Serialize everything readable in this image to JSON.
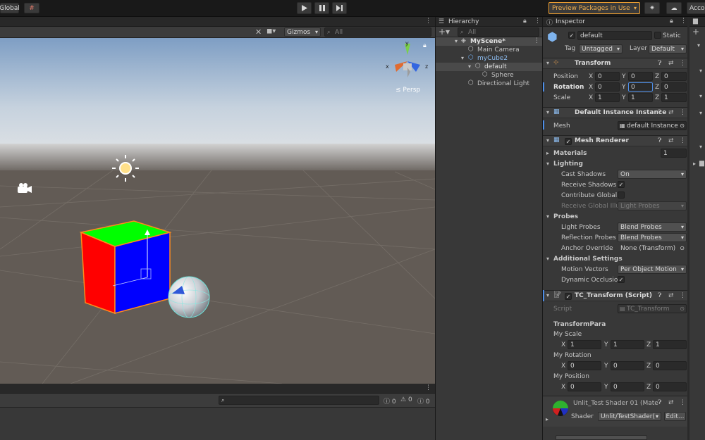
{
  "toolbar": {
    "global_label": "Global",
    "preview_packages": "Preview Packages in Use",
    "account_label": "Acco"
  },
  "scene": {
    "gizmos_label": "Gizmos",
    "search_placeholder": "All",
    "persp_label": "≤ Persp",
    "axis_x": "x",
    "axis_y": "y",
    "axis_z": "z"
  },
  "console": {
    "search_placeholder": "",
    "count_info": "0",
    "count_warn": "0",
    "count_error": "0"
  },
  "hierarchy": {
    "title": "Hierarchy",
    "search_placeholder": "All",
    "items": [
      {
        "label": "MyScene*"
      },
      {
        "label": "Main Camera"
      },
      {
        "label": "myCube2"
      },
      {
        "label": "default"
      },
      {
        "label": "Sphere"
      },
      {
        "label": "Directional Light"
      }
    ]
  },
  "inspector": {
    "title": "Inspector",
    "object_name": "default",
    "static_label": "Static",
    "tag_label": "Tag",
    "tag_value": "Untagged",
    "layer_label": "Layer",
    "layer_value": "Default",
    "transform": {
      "title": "Transform",
      "position_label": "Position",
      "rotation_label": "Rotation",
      "scale_label": "Scale",
      "position": {
        "x": "0",
        "y": "0",
        "z": "0"
      },
      "rotation": {
        "x": "0",
        "y": "0",
        "z": "0"
      },
      "scale": {
        "x": "1",
        "y": "1",
        "z": "1"
      }
    },
    "default_instance": {
      "title": "Default Instance Instance",
      "mesh_label": "Mesh",
      "mesh_value": "default Instance"
    },
    "mesh_renderer": {
      "title": "Mesh Renderer",
      "materials_label": "Materials",
      "materials_count": "1",
      "lighting_label": "Lighting",
      "cast_shadows_label": "Cast Shadows",
      "cast_shadows_value": "On",
      "receive_shadows_label": "Receive Shadows",
      "contribute_gi_label": "Contribute Global I",
      "receive_gi_label": "Receive Global Illu",
      "receive_gi_value": "Light Probes",
      "probes_label": "Probes",
      "light_probes_label": "Light Probes",
      "light_probes_value": "Blend Probes",
      "reflection_probes_label": "Reflection Probes",
      "reflection_probes_value": "Blend Probes",
      "anchor_override_label": "Anchor Override",
      "anchor_override_value": "None (Transform)",
      "additional_label": "Additional Settings",
      "motion_vectors_label": "Motion Vectors",
      "motion_vectors_value": "Per Object Motion",
      "dynamic_occlusion_label": "Dynamic Occlusio"
    },
    "tc_transform": {
      "title": "TC_Transform (Script)",
      "script_label": "Script",
      "script_value": "TC_Transform",
      "transform_para_label": "TransformPara",
      "my_scale_label": "My Scale",
      "my_rotation_label": "My Rotation",
      "my_position_label": "My Position",
      "my_scale": {
        "x": "1",
        "y": "1",
        "z": "1"
      },
      "my_rotation": {
        "x": "0",
        "y": "0",
        "z": "0"
      },
      "my_position": {
        "x": "0",
        "y": "0",
        "z": "0"
      }
    },
    "material": {
      "title": "Unlit_Test Shader 01 (Mate",
      "shader_label": "Shader",
      "shader_value": "Unlit/TestShader(",
      "edit_label": "Edit..."
    }
  },
  "colors": {
    "accent_blue": "#4d8ee8",
    "preview_orange": "#f0a030",
    "cube_red": "#ff0000",
    "cube_green": "#00ff00",
    "cube_blue": "#0000ff",
    "selection_outline": "#ff8a1c"
  }
}
